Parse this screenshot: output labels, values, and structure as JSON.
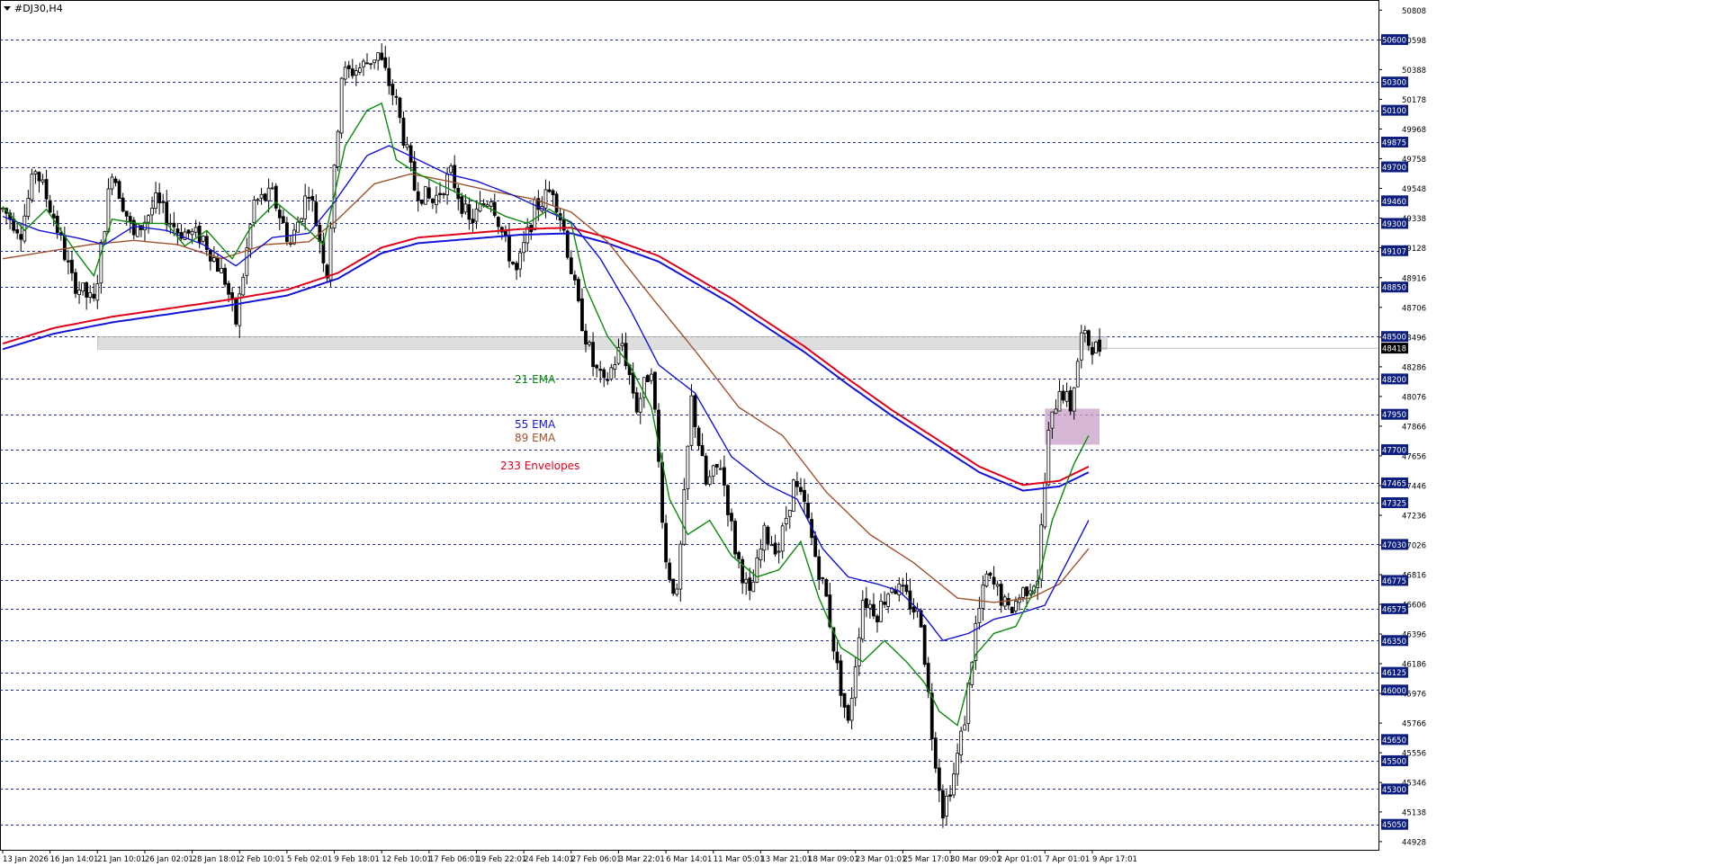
{
  "window": {
    "title": "#DJ30,H4"
  },
  "colors": {
    "background": "#ffffff",
    "grid": "#1c2b8f",
    "candle": "#000000",
    "ema21": "#0a8a0a",
    "ema55": "#1414d8",
    "ema89": "#a0522d",
    "env_upper": "#e0001b",
    "env_lower": "#1414d8",
    "zone_gray": "#c8c8c8",
    "zone_purple": "#c8a0c8",
    "price_label_bg": "#0c1e7e",
    "price_label_text": "#ffffff"
  },
  "annotations": [
    {
      "text": "21 EMA",
      "color": "#0a8a0a"
    },
    {
      "text": "55 EMA",
      "color": "#1414d8"
    },
    {
      "text": "89 EMA",
      "color": "#a0522d"
    },
    {
      "text": "233 Envelopes",
      "color": "#e0001b"
    }
  ],
  "chart_data": {
    "type": "candlestick",
    "symbol": "#DJ30",
    "timeframe": "H4",
    "y_range": [
      44870,
      50880
    ],
    "y_axis_ticks": [
      "50808",
      "50598",
      "50388",
      "50178",
      "49968",
      "49758",
      "49548",
      "49338",
      "49128",
      "48916",
      "48706",
      "48496",
      "48286",
      "48076",
      "47866",
      "47656",
      "47446",
      "47236",
      "47026",
      "46816",
      "46606",
      "46396",
      "46186",
      "45976",
      "45766",
      "45556",
      "45346",
      "45138",
      "44928"
    ],
    "level_lines": [
      50600,
      50300,
      50100,
      49875,
      49700,
      49460,
      49300,
      49107,
      48850,
      48500,
      48200,
      47950,
      47700,
      47465,
      47325,
      47030,
      46775,
      46575,
      46350,
      46125,
      46000,
      45650,
      45500,
      45300,
      45050
    ],
    "level_labels": [
      "50600",
      "50300",
      "50100",
      "49875",
      "49700",
      "49460",
      "49300",
      "49107",
      "48850",
      "48500",
      "48200",
      "47950",
      "47700",
      "47465",
      "47325",
      "47030",
      "46775",
      "46575",
      "46350",
      "46125",
      "46000",
      "45650",
      "45500",
      "45300",
      "45050"
    ],
    "current_price": 48418,
    "current_price_label": "48418",
    "x_labels": [
      "13 Jan 2026",
      "16 Jan 14:01",
      "21 Jan 10:01",
      "26 Jan 02:01",
      "28 Jan 18:01",
      "2 Feb 10:01",
      "5 Feb 02:01",
      "9 Feb 18:01",
      "12 Feb 10:01",
      "17 Feb 06:01",
      "19 Feb 22:01",
      "24 Feb 14:01",
      "27 Feb 06:01",
      "3 Mar 22:01",
      "6 Mar 14:01",
      "11 Mar 05:01",
      "13 Mar 21:01",
      "18 Mar 09:01",
      "23 Mar 01:01",
      "25 Mar 17:01",
      "30 Mar 09:01",
      "2 Apr 01:01",
      "7 Apr 01:01",
      "9 Apr 17:01"
    ],
    "zones": [
      {
        "name": "support-resistance",
        "from_bar": 26,
        "to_bar": 303,
        "low": 48410,
        "high": 48500
      },
      {
        "name": "retest-box",
        "from_bar": 286,
        "to_bar": 301,
        "low": 47735,
        "high": 47990
      }
    ],
    "close_path": [
      [
        0,
        49400
      ],
      [
        5,
        49250
      ],
      [
        9,
        49690
      ],
      [
        14,
        49350
      ],
      [
        19,
        48900
      ],
      [
        25,
        48730
      ],
      [
        30,
        49690
      ],
      [
        36,
        49200
      ],
      [
        42,
        49450
      ],
      [
        48,
        49250
      ],
      [
        55,
        49200
      ],
      [
        61,
        48900
      ],
      [
        64,
        48600
      ],
      [
        69,
        49450
      ],
      [
        74,
        49500
      ],
      [
        79,
        49150
      ],
      [
        84,
        49550
      ],
      [
        89,
        48950
      ],
      [
        93,
        50350
      ],
      [
        98,
        50400
      ],
      [
        103,
        50500
      ],
      [
        108,
        50150
      ],
      [
        113,
        49550
      ],
      [
        118,
        49450
      ],
      [
        123,
        49650
      ],
      [
        128,
        49300
      ],
      [
        134,
        49500
      ],
      [
        138,
        49150
      ],
      [
        141,
        48950
      ],
      [
        146,
        49400
      ],
      [
        151,
        49550
      ],
      [
        154,
        49250
      ],
      [
        158,
        48700
      ],
      [
        162,
        48300
      ],
      [
        165,
        48150
      ],
      [
        170,
        48450
      ],
      [
        174,
        48000
      ],
      [
        178,
        48300
      ],
      [
        182,
        46900
      ],
      [
        185,
        46650
      ],
      [
        189,
        48050
      ],
      [
        193,
        47450
      ],
      [
        197,
        47600
      ],
      [
        201,
        47000
      ],
      [
        205,
        46650
      ],
      [
        209,
        47100
      ],
      [
        213,
        47000
      ],
      [
        217,
        47450
      ],
      [
        220,
        47300
      ],
      [
        223,
        46950
      ],
      [
        226,
        46650
      ],
      [
        229,
        46150
      ],
      [
        232,
        45750
      ],
      [
        236,
        46650
      ],
      [
        240,
        46550
      ],
      [
        244,
        46750
      ],
      [
        248,
        46650
      ],
      [
        252,
        46500
      ],
      [
        255,
        45700
      ],
      [
        258,
        45150
      ],
      [
        261,
        45400
      ],
      [
        264,
        45800
      ],
      [
        267,
        46450
      ],
      [
        270,
        46800
      ],
      [
        273,
        46700
      ],
      [
        276,
        46550
      ],
      [
        280,
        46700
      ],
      [
        284,
        46800
      ],
      [
        287,
        47800
      ],
      [
        290,
        48150
      ],
      [
        293,
        48000
      ],
      [
        296,
        48500
      ],
      [
        300,
        48418
      ]
    ],
    "ema21_path": [
      [
        0,
        49420
      ],
      [
        6,
        49250
      ],
      [
        12,
        49400
      ],
      [
        20,
        49100
      ],
      [
        25,
        48930
      ],
      [
        30,
        49330
      ],
      [
        37,
        49300
      ],
      [
        45,
        49300
      ],
      [
        50,
        49140
      ],
      [
        56,
        49250
      ],
      [
        63,
        49050
      ],
      [
        68,
        49270
      ],
      [
        75,
        49450
      ],
      [
        82,
        49300
      ],
      [
        88,
        49150
      ],
      [
        94,
        49850
      ],
      [
        100,
        50100
      ],
      [
        104,
        50150
      ],
      [
        108,
        49750
      ],
      [
        114,
        49650
      ],
      [
        122,
        49550
      ],
      [
        130,
        49450
      ],
      [
        138,
        49350
      ],
      [
        144,
        49300
      ],
      [
        150,
        49400
      ],
      [
        156,
        49300
      ],
      [
        160,
        48850
      ],
      [
        166,
        48500
      ],
      [
        172,
        48300
      ],
      [
        178,
        48000
      ],
      [
        183,
        47350
      ],
      [
        188,
        47100
      ],
      [
        194,
        47200
      ],
      [
        200,
        46950
      ],
      [
        207,
        46800
      ],
      [
        213,
        46850
      ],
      [
        219,
        47050
      ],
      [
        224,
        46650
      ],
      [
        230,
        46300
      ],
      [
        236,
        46200
      ],
      [
        242,
        46350
      ],
      [
        248,
        46200
      ],
      [
        253,
        46050
      ],
      [
        257,
        45850
      ],
      [
        262,
        45750
      ],
      [
        267,
        46250
      ],
      [
        272,
        46400
      ],
      [
        278,
        46450
      ],
      [
        284,
        46750
      ],
      [
        288,
        47200
      ],
      [
        294,
        47600
      ],
      [
        298,
        47800
      ]
    ],
    "ema55_path": [
      [
        0,
        49350
      ],
      [
        10,
        49250
      ],
      [
        20,
        49200
      ],
      [
        28,
        49150
      ],
      [
        36,
        49280
      ],
      [
        45,
        49250
      ],
      [
        55,
        49150
      ],
      [
        64,
        49000
      ],
      [
        74,
        49200
      ],
      [
        84,
        49230
      ],
      [
        91,
        49450
      ],
      [
        100,
        49780
      ],
      [
        106,
        49850
      ],
      [
        114,
        49750
      ],
      [
        122,
        49650
      ],
      [
        130,
        49600
      ],
      [
        140,
        49500
      ],
      [
        150,
        49380
      ],
      [
        156,
        49310
      ],
      [
        164,
        49050
      ],
      [
        172,
        48700
      ],
      [
        180,
        48300
      ],
      [
        190,
        48100
      ],
      [
        200,
        47650
      ],
      [
        210,
        47450
      ],
      [
        218,
        47350
      ],
      [
        225,
        47000
      ],
      [
        232,
        46800
      ],
      [
        240,
        46750
      ],
      [
        246,
        46700
      ],
      [
        252,
        46550
      ],
      [
        258,
        46350
      ],
      [
        265,
        46400
      ],
      [
        272,
        46500
      ],
      [
        280,
        46550
      ],
      [
        286,
        46600
      ],
      [
        292,
        46900
      ],
      [
        298,
        47200
      ]
    ],
    "ema89_path": [
      [
        0,
        49050
      ],
      [
        12,
        49100
      ],
      [
        24,
        49150
      ],
      [
        36,
        49180
      ],
      [
        48,
        49150
      ],
      [
        60,
        49050
      ],
      [
        72,
        49150
      ],
      [
        84,
        49170
      ],
      [
        92,
        49330
      ],
      [
        102,
        49580
      ],
      [
        112,
        49650
      ],
      [
        122,
        49600
      ],
      [
        134,
        49530
      ],
      [
        146,
        49470
      ],
      [
        156,
        49380
      ],
      [
        166,
        49170
      ],
      [
        178,
        48780
      ],
      [
        190,
        48400
      ],
      [
        202,
        48000
      ],
      [
        214,
        47800
      ],
      [
        226,
        47400
      ],
      [
        238,
        47100
      ],
      [
        250,
        46900
      ],
      [
        262,
        46650
      ],
      [
        272,
        46620
      ],
      [
        282,
        46650
      ],
      [
        290,
        46750
      ],
      [
        298,
        47000
      ]
    ],
    "env_upper_path": [
      [
        0,
        48450
      ],
      [
        14,
        48560
      ],
      [
        30,
        48640
      ],
      [
        46,
        48700
      ],
      [
        62,
        48760
      ],
      [
        78,
        48830
      ],
      [
        92,
        48950
      ],
      [
        104,
        49130
      ],
      [
        114,
        49200
      ],
      [
        128,
        49230
      ],
      [
        142,
        49260
      ],
      [
        156,
        49270
      ],
      [
        166,
        49200
      ],
      [
        180,
        49070
      ],
      [
        190,
        48920
      ],
      [
        200,
        48770
      ],
      [
        210,
        48600
      ],
      [
        220,
        48430
      ],
      [
        232,
        48200
      ],
      [
        244,
        47980
      ],
      [
        256,
        47780
      ],
      [
        268,
        47580
      ],
      [
        280,
        47450
      ],
      [
        290,
        47480
      ],
      [
        298,
        47580
      ]
    ],
    "env_lower_path": [
      [
        0,
        48410
      ],
      [
        14,
        48520
      ],
      [
        30,
        48600
      ],
      [
        46,
        48660
      ],
      [
        62,
        48720
      ],
      [
        78,
        48790
      ],
      [
        92,
        48910
      ],
      [
        104,
        49090
      ],
      [
        114,
        49160
      ],
      [
        128,
        49190
      ],
      [
        142,
        49220
      ],
      [
        156,
        49230
      ],
      [
        166,
        49160
      ],
      [
        180,
        49030
      ],
      [
        190,
        48880
      ],
      [
        200,
        48730
      ],
      [
        210,
        48560
      ],
      [
        220,
        48390
      ],
      [
        232,
        48160
      ],
      [
        244,
        47940
      ],
      [
        256,
        47740
      ],
      [
        268,
        47540
      ],
      [
        280,
        47410
      ],
      [
        290,
        47440
      ],
      [
        298,
        47540
      ]
    ],
    "bars": 302
  }
}
